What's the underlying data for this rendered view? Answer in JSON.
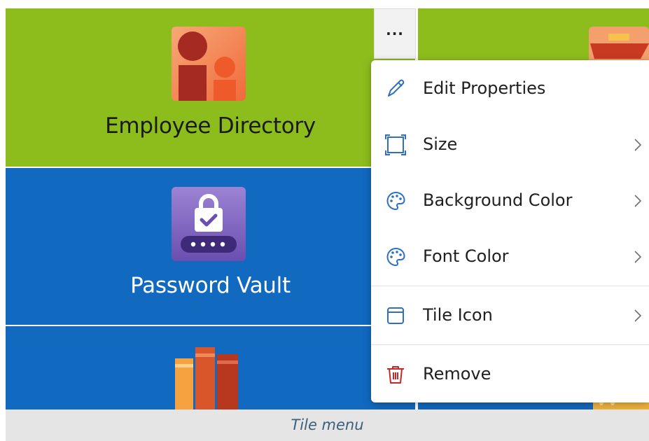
{
  "colors": {
    "tile_green": "#8cbd1d",
    "tile_blue": "#1169c0",
    "menu_icon_blue": "#2f6fc0",
    "remove_icon_red": "#c4272c",
    "caption_text": "#3c5f7a"
  },
  "tiles": [
    {
      "label": "Employee Directory",
      "icon": "employee-directory-icon",
      "background": "#8cbd1d",
      "font_color": "#1a1a1a"
    },
    {
      "label": "Password Vault",
      "icon": "password-vault-icon",
      "background": "#1169c0",
      "font_color": "#ffffff"
    },
    {
      "label": "",
      "icon": "library-books-icon",
      "background": "#1169c0",
      "font_color": "#ffffff"
    }
  ],
  "more_button": {
    "label": "...",
    "icon": "more-options-icon"
  },
  "tile_menu": {
    "items": [
      {
        "label": "Edit Properties",
        "icon": "pencil-icon",
        "has_submenu": false
      },
      {
        "label": "Size",
        "icon": "resize-frame-icon",
        "has_submenu": true
      },
      {
        "label": "Background Color",
        "icon": "palette-icon",
        "has_submenu": true
      },
      {
        "label": "Font Color",
        "icon": "palette-icon",
        "has_submenu": true
      },
      {
        "label": "Tile Icon",
        "icon": "window-icon",
        "has_submenu": true
      },
      {
        "label": "Remove",
        "icon": "trash-icon",
        "has_submenu": false
      }
    ]
  },
  "caption": "Tile menu"
}
